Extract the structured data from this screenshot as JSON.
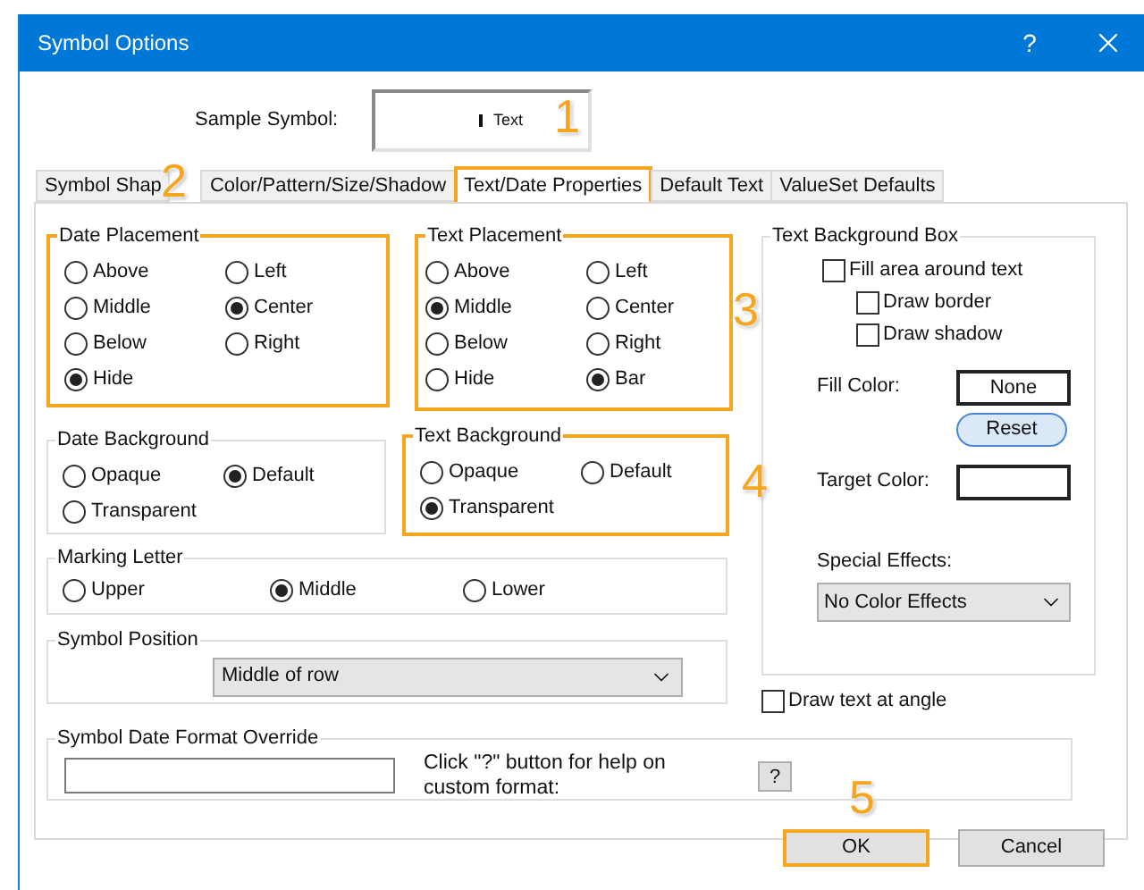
{
  "window": {
    "title": "Symbol Options",
    "help_label": "?"
  },
  "sample_symbol": {
    "label": "Sample Symbol:",
    "text": "Text"
  },
  "tabs": [
    {
      "label": "Symbol Shap",
      "selected": false,
      "highlighted": false
    },
    {
      "label": "Color/Pattern/Size/Shadow",
      "selected": false,
      "highlighted": false
    },
    {
      "label": "Text/Date Properties",
      "selected": true,
      "highlighted": true
    },
    {
      "label": "Default Text",
      "selected": false,
      "highlighted": false
    },
    {
      "label": "ValueSet Defaults",
      "selected": false,
      "highlighted": false
    }
  ],
  "date_placement": {
    "title": "Date Placement",
    "highlighted": true,
    "options": [
      {
        "label": "Above",
        "selected": false
      },
      {
        "label": "Left",
        "selected": false
      },
      {
        "label": "Middle",
        "selected": false
      },
      {
        "label": "Center",
        "selected": true
      },
      {
        "label": "Below",
        "selected": false
      },
      {
        "label": "Right",
        "selected": false
      },
      {
        "label": "Hide",
        "selected": true
      }
    ]
  },
  "text_placement": {
    "title": "Text Placement",
    "highlighted": true,
    "options": [
      {
        "label": "Above",
        "selected": false
      },
      {
        "label": "Left",
        "selected": false
      },
      {
        "label": "Middle",
        "selected": true
      },
      {
        "label": "Center",
        "selected": false
      },
      {
        "label": "Below",
        "selected": false
      },
      {
        "label": "Right",
        "selected": false
      },
      {
        "label": "Hide",
        "selected": false
      },
      {
        "label": "Bar",
        "selected": true
      }
    ]
  },
  "date_background": {
    "title": "Date Background",
    "highlighted": false,
    "options": [
      {
        "label": "Opaque",
        "selected": false
      },
      {
        "label": "Default",
        "selected": true
      },
      {
        "label": "Transparent",
        "selected": false
      }
    ]
  },
  "text_background": {
    "title": "Text Background",
    "highlighted": true,
    "options": [
      {
        "label": "Opaque",
        "selected": false
      },
      {
        "label": "Default",
        "selected": false
      },
      {
        "label": "Transparent",
        "selected": true
      }
    ]
  },
  "marking_letter": {
    "title": "Marking Letter",
    "highlighted": false,
    "options": [
      {
        "label": "Upper",
        "selected": false
      },
      {
        "label": "Middle",
        "selected": true
      },
      {
        "label": "Lower",
        "selected": false
      }
    ]
  },
  "symbol_position": {
    "title": "Symbol Position",
    "value": "Middle of row"
  },
  "text_background_box": {
    "title": "Text Background Box",
    "checkboxes": [
      {
        "label": "Fill area around text",
        "checked": false,
        "children": [
          {
            "label": "Draw border",
            "checked": false
          },
          {
            "label": "Draw shadow",
            "checked": false
          }
        ]
      }
    ],
    "fill_color": {
      "label": "Fill Color:",
      "value": "None"
    },
    "reset_button": "Reset",
    "target_color": {
      "label": "Target Color:"
    },
    "special_effects": {
      "label": "Special Effects:",
      "value": "No Color Effects"
    }
  },
  "draw_text_at_angle": {
    "label": "Draw text at angle",
    "checked": false
  },
  "date_format_override": {
    "title": "Symbol Date Format Override",
    "hint": "Click \"?\" button for help on custom format:",
    "help_button": "?"
  },
  "buttons": [
    {
      "label": "OK",
      "highlighted": true
    },
    {
      "label": "Cancel",
      "highlighted": false
    }
  ],
  "callouts": [
    {
      "label": "1"
    },
    {
      "label": "2"
    },
    {
      "label": "3"
    },
    {
      "label": "4"
    },
    {
      "label": "5"
    }
  ]
}
